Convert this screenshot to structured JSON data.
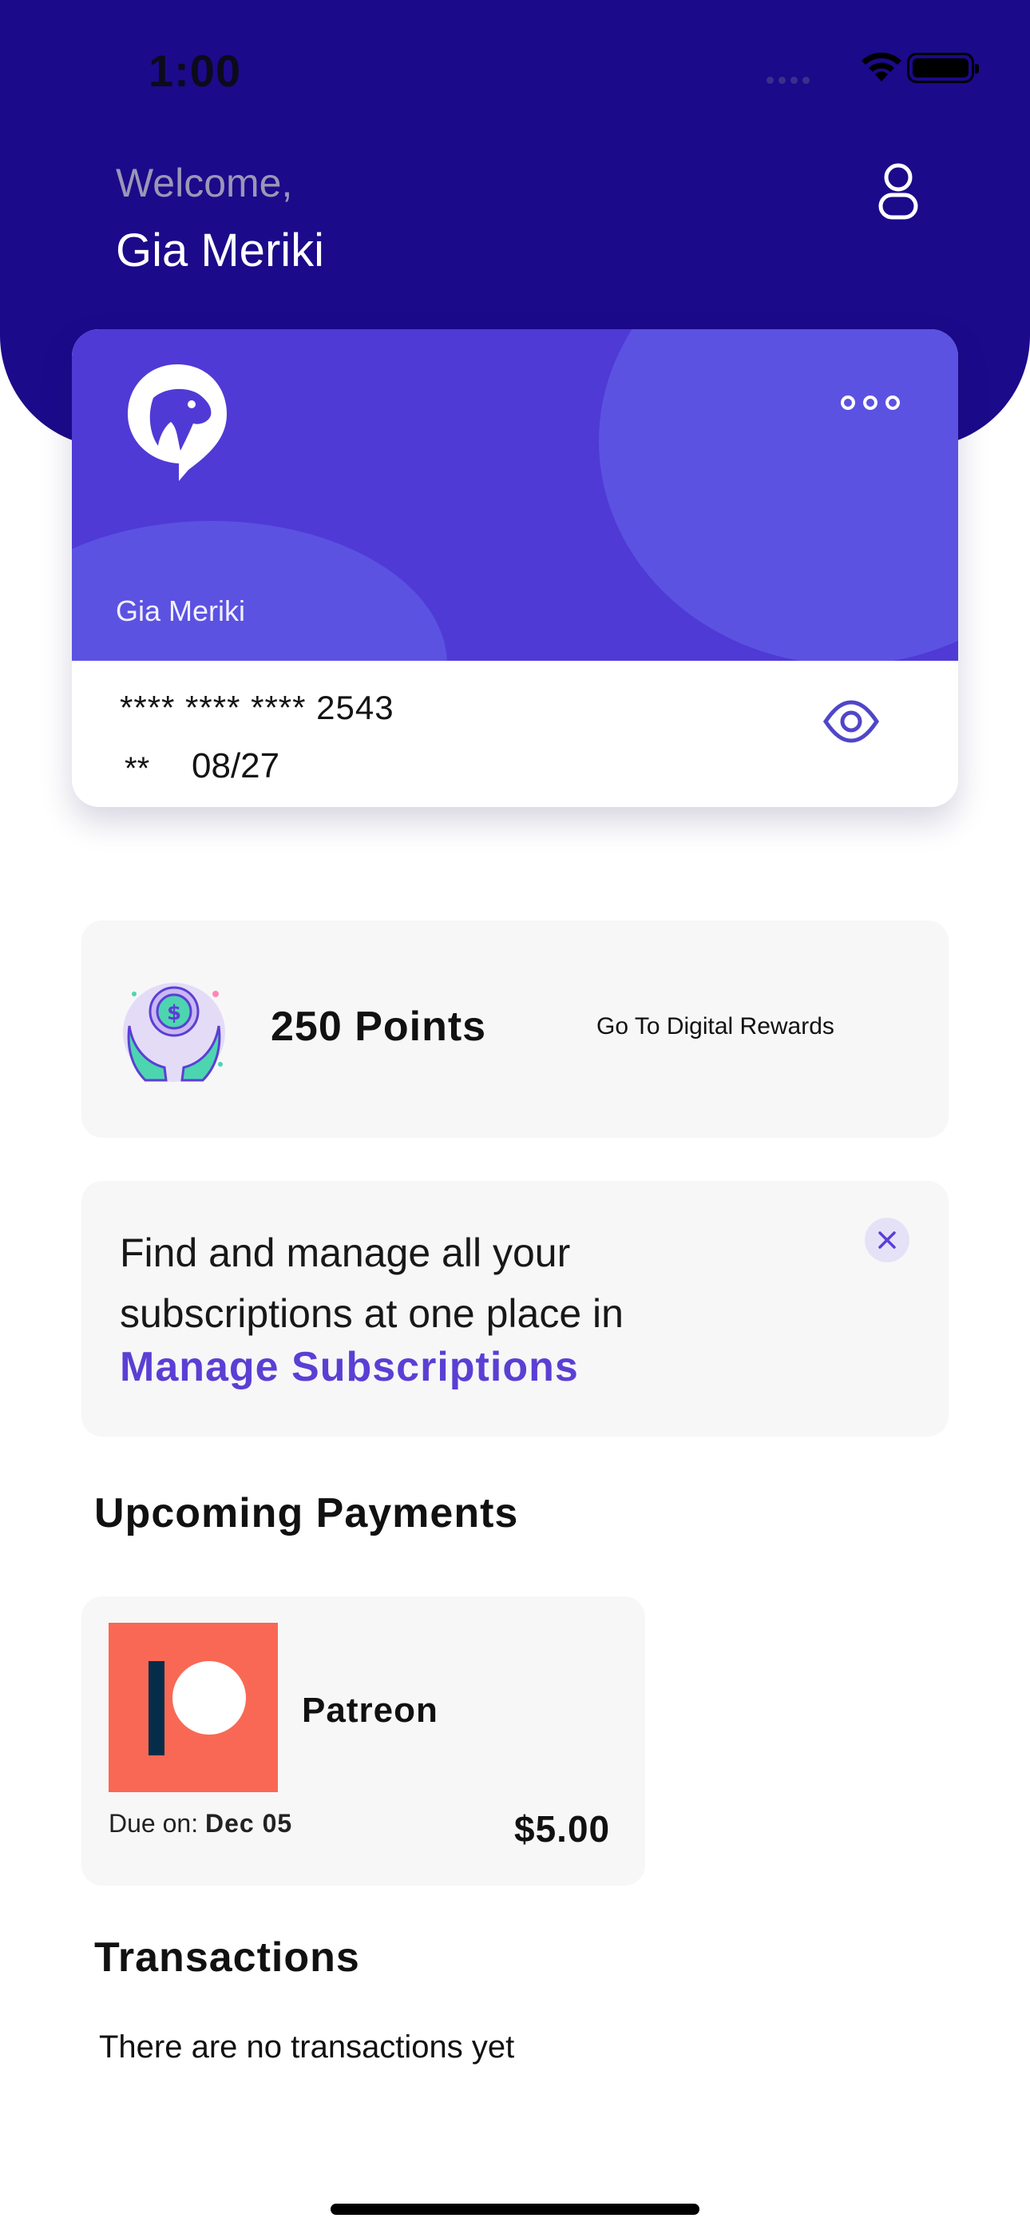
{
  "status_bar": {
    "time": "1:00"
  },
  "header": {
    "greeting": "Welcome,",
    "user_name": "Gia Meriki",
    "profile_icon": "user-icon"
  },
  "card": {
    "holder": "Gia Meriki",
    "number": "**** **** **** 2543",
    "cvv": "**",
    "expiry": "08/27",
    "logo_icon": "dog-logo-icon",
    "menu_icon": "more-dots-icon",
    "reveal_icon": "eye-icon",
    "color": "#4f3ad6"
  },
  "rewards": {
    "points": "250 Points",
    "link": "Go To Digital Rewards",
    "icon": "money-hands-icon"
  },
  "subscriptions_banner": {
    "text": "Find and manage all your subscriptions at one place in",
    "link": "Manage Subscriptions",
    "close_icon": "close-icon",
    "accent": "#5b3fd4"
  },
  "upcoming": {
    "title": "Upcoming Payments",
    "items": [
      {
        "name": "Patreon",
        "due_label": "Due on:",
        "due_date": "Dec 05",
        "amount": "$5.00",
        "logo": "patreon-logo",
        "logo_color": "#f96854"
      }
    ]
  },
  "transactions": {
    "title": "Transactions",
    "empty": "There are no transactions yet"
  },
  "colors": {
    "header_bg": "#1b0a8a"
  }
}
